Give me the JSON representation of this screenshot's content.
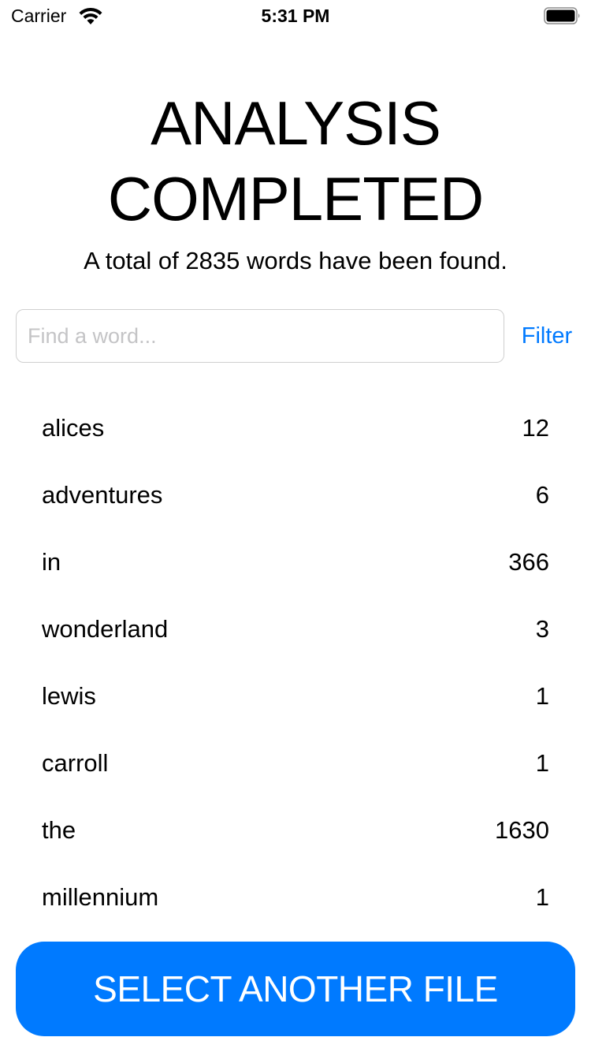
{
  "status_bar": {
    "carrier": "Carrier",
    "time": "5:31 PM",
    "wifi_icon": "wifi-icon",
    "battery_icon": "battery-icon"
  },
  "header": {
    "title_line1": "ANALYSIS",
    "title_line2": "COMPLETED",
    "summary": "A total of 2835 words have been found."
  },
  "search": {
    "placeholder": "Find a word...",
    "value": "",
    "filter_label": "Filter"
  },
  "words": [
    {
      "word": "alices",
      "count": "12"
    },
    {
      "word": "adventures",
      "count": "6"
    },
    {
      "word": "in",
      "count": "366"
    },
    {
      "word": "wonderland",
      "count": "3"
    },
    {
      "word": "lewis",
      "count": "1"
    },
    {
      "word": "carroll",
      "count": "1"
    },
    {
      "word": "the",
      "count": "1630"
    },
    {
      "word": "millennium",
      "count": "1"
    }
  ],
  "footer": {
    "select_button_label": "SELECT ANOTHER FILE"
  },
  "colors": {
    "accent": "#007aff",
    "background": "#ffffff",
    "text": "#000000",
    "placeholder": "#c4c4c6"
  }
}
